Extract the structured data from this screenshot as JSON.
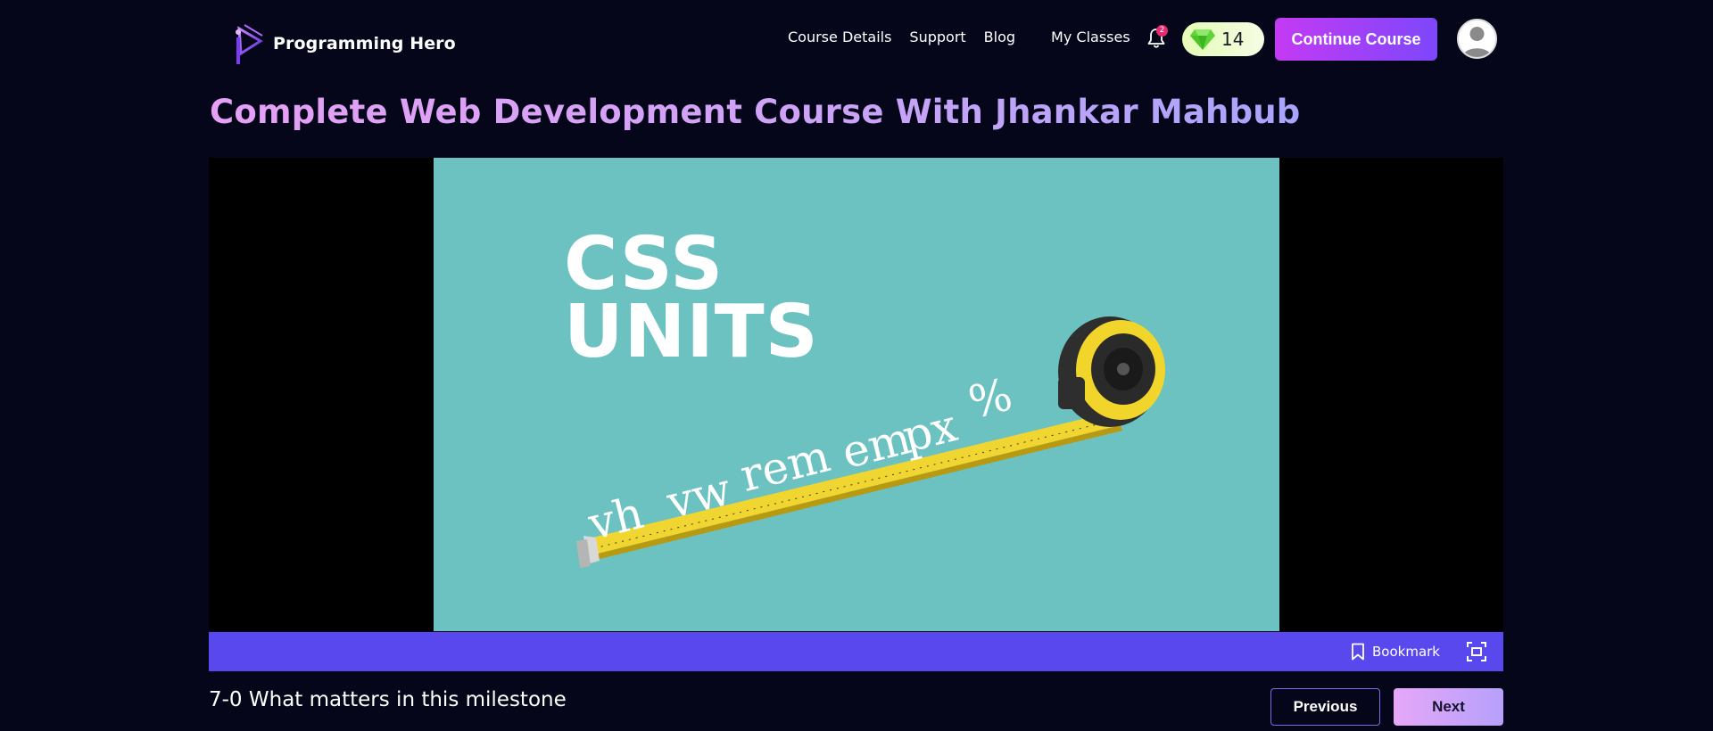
{
  "header": {
    "brand": "Programming Hero",
    "nav": [
      {
        "label": "Course Details"
      },
      {
        "label": "Support"
      },
      {
        "label": "Blog"
      },
      {
        "label": "My Classes"
      }
    ],
    "notification_count": "2",
    "gems": "14",
    "continue_label": "Continue Course",
    "icons": {
      "logo": "programming-hero-logo",
      "bell": "bell-icon",
      "gem": "gem-icon",
      "avatar": "user-avatar-icon"
    }
  },
  "course": {
    "title": "Complete Web Development Course With Jhankar Mahbub"
  },
  "video": {
    "thumbnail": {
      "heading_line1": "CSS",
      "heading_line2": "UNITS",
      "units": [
        "vh",
        "vw",
        "rem",
        "em",
        "px",
        "%"
      ],
      "background_color": "#6cc2c1"
    },
    "controls": {
      "bookmark_label": "Bookmark",
      "bar_color": "#5a48ef"
    }
  },
  "lesson": {
    "title": "7-0 What matters in this milestone",
    "previous_label": "Previous",
    "next_label": "Next"
  },
  "colors": {
    "background": "#05061a",
    "accent_purple": "#7d47fb",
    "accent_pink": "#c43af4"
  }
}
